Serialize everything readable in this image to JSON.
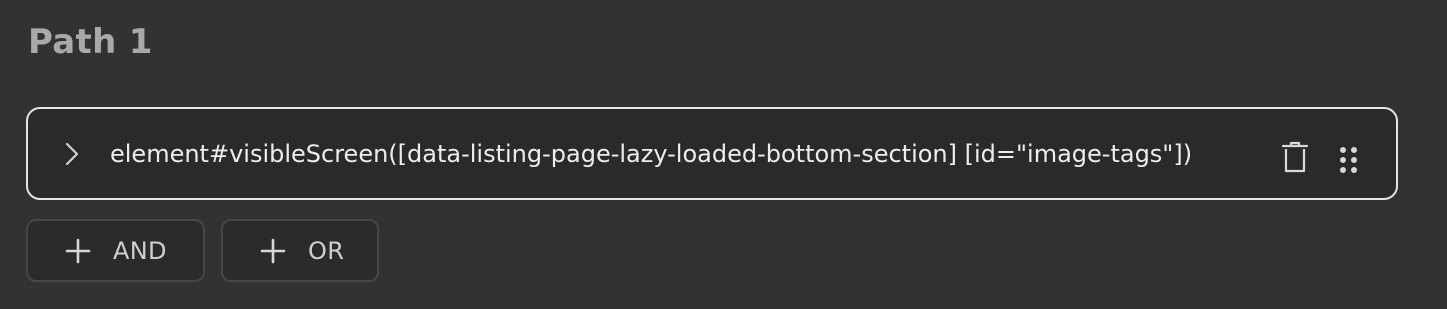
{
  "path": {
    "title": "Path 1"
  },
  "condition": {
    "text": "element#visibleScreen([data-listing-page-lazy-loaded-bottom-section] [id=\"image-tags\"])",
    "expand_icon": "chevron-right-icon",
    "delete_icon": "trash-icon",
    "drag_icon": "drag-handle-icon"
  },
  "actions": {
    "and_label": "AND",
    "or_label": "OR",
    "add_icon": "plus-icon"
  },
  "colors": {
    "background": "#323232",
    "border": "#e6e6e6",
    "text": "#ededed",
    "muted": "#a9a9a9"
  }
}
